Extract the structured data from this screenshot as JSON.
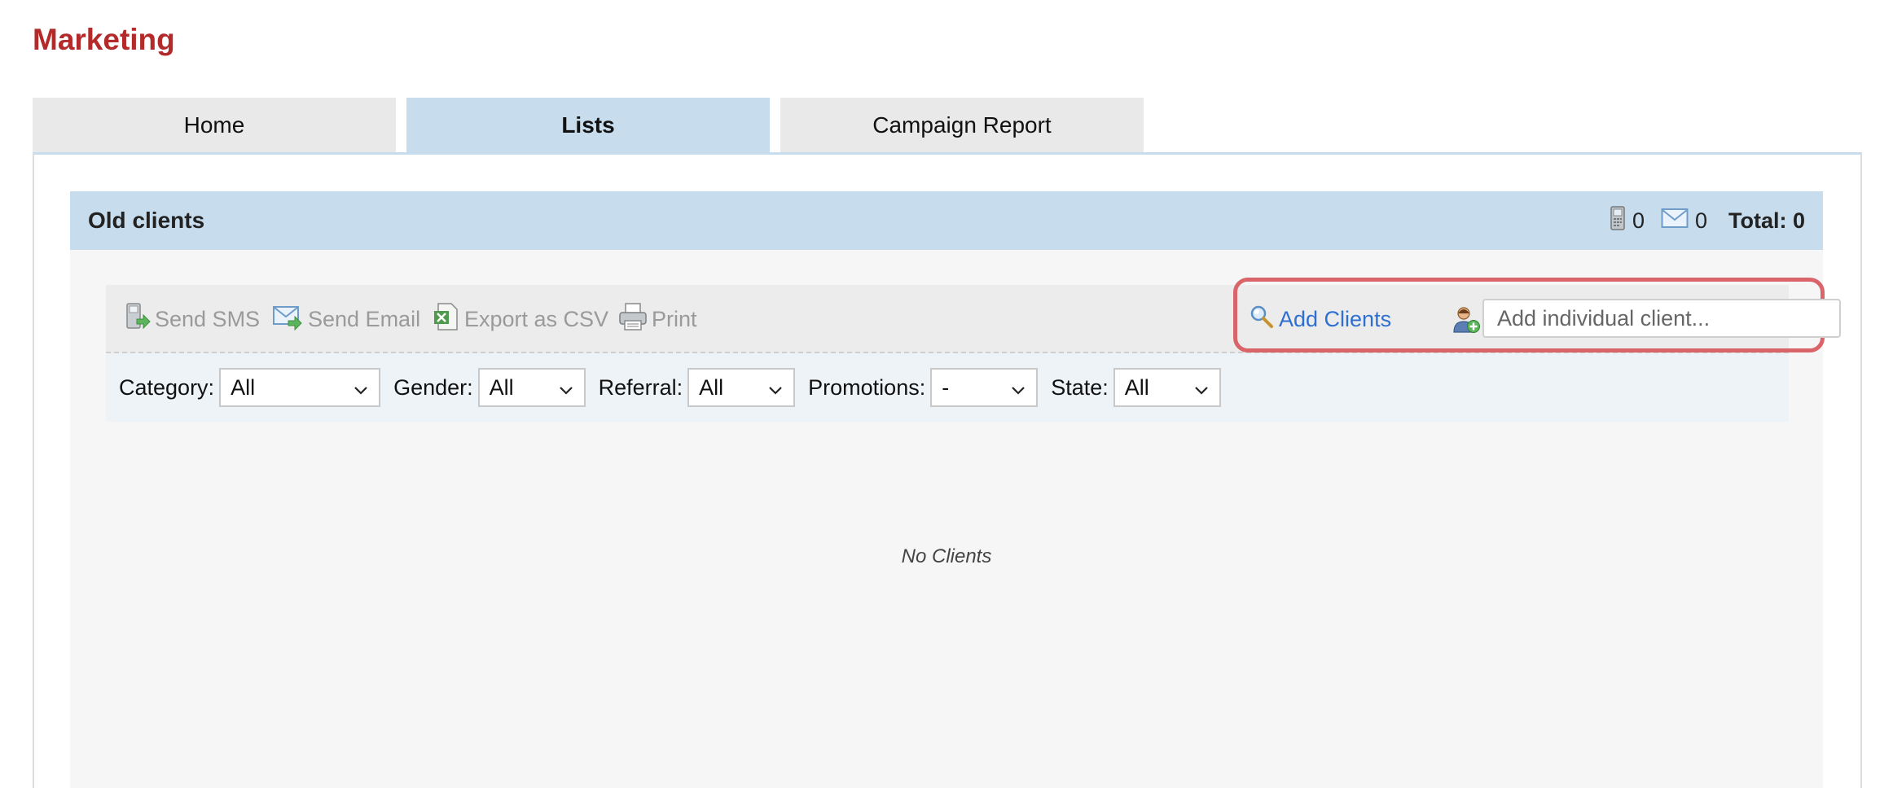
{
  "app": {
    "title": "Marketing"
  },
  "tabs": [
    {
      "label": "Home",
      "active": false
    },
    {
      "label": "Lists",
      "active": true
    },
    {
      "label": "Campaign Report",
      "active": false
    }
  ],
  "list": {
    "name": "Old clients",
    "phone_count": "0",
    "email_count": "0",
    "total": "Total: 0"
  },
  "toolbar": {
    "send_sms": "Send SMS",
    "send_email": "Send Email",
    "export_csv": "Export as CSV",
    "print": "Print",
    "add_clients": "Add Clients",
    "add_individual_placeholder": "Add individual client..."
  },
  "filters": {
    "category_label": "Category:",
    "category_value": "All",
    "gender_label": "Gender:",
    "gender_value": "All",
    "referral_label": "Referral:",
    "referral_value": "All",
    "promotions_label": "Promotions:",
    "promotions_value": "-",
    "state_label": "State:",
    "state_value": "All"
  },
  "empty_message": "No Clients",
  "colors": {
    "title": "#b22a2a",
    "accent_tab": "#c7dcec",
    "link": "#2f6fd0",
    "highlight": "#d9656b"
  },
  "icons": [
    "phone-icon",
    "envelope-icon",
    "sms-icon",
    "email-send-icon",
    "csv-icon",
    "printer-icon",
    "magnifier-icon",
    "add-person-icon",
    "chevron-down-icon"
  ]
}
